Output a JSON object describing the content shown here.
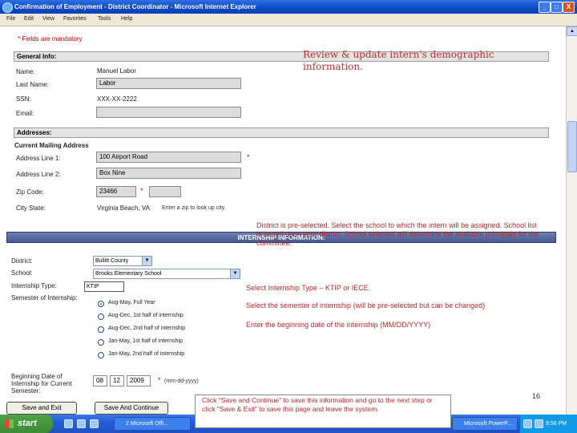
{
  "window": {
    "title": "Confirmation of Employment - District Coordinator - Microsoft Internet Explorer",
    "controls": [
      "_",
      "□",
      "X"
    ]
  },
  "menu": [
    "File",
    "Edit",
    "View",
    "Favorites",
    "Tools",
    "Help"
  ],
  "form": {
    "mandatory_note": "* Fields are mandatory",
    "general_header": "General Info:",
    "name_label": "Name:",
    "name_value": "Manuel Labor",
    "last_name_label": "Last Name:",
    "last_name_value": "Labor",
    "ssn_label": "SSN:",
    "ssn_value": "XXX-XX-2222",
    "email_label": "Email:",
    "email_value": "",
    "addresses_header": "Addresses:",
    "mailing_label": "Current Mailing Address",
    "addr1_label": "Address Line 1:",
    "addr1_value": "100 Airport Road",
    "addr2_label": "Address Line 2:",
    "addr2_value": "Box Nine",
    "zip_label": "Zip Code:",
    "zip_value": "23466",
    "city_label": "City State:",
    "city_value": "Virginia Beach, VA",
    "city_hint": "Enter a zip to look up city.",
    "star": "*"
  },
  "internship": {
    "header": "INTERNSHIP INFORMATION:",
    "district_label": "District:",
    "district_value": "Bullitt County",
    "school_label": "School:",
    "school_value": "Brooks Elementary School",
    "type_label": "Internship Type:",
    "type_value": "KTIP",
    "semester_label": "Semester of Internship:",
    "semesters": [
      {
        "label": "Aug-May, Full Year",
        "checked": true
      },
      {
        "label": "Aug-Dec, 1st half of internship",
        "checked": false
      },
      {
        "label": "Aug-Dec, 2nd half of internship",
        "checked": false
      },
      {
        "label": "Jan-May, 1st half of internship",
        "checked": false
      },
      {
        "label": "Jan-May, 2nd half of internship",
        "checked": false
      }
    ],
    "begin_label_1": "Beginning Date of",
    "begin_label_2": "Internship for Current",
    "begin_label_3": "Semester:",
    "date_mm": "08",
    "date_dd": "12",
    "date_yyyy": "2009",
    "date_hint": "(mm-dd-yyyy)",
    "save_exit": "Save and Exit",
    "save_continue": "Save And Continue"
  },
  "annotations": {
    "demographic": "Review & update intern's demographic information.",
    "district": "District is pre-selected. Select the school to which the intern will be assigned. School list is based upon your district. School selected will determine the available principals for the committee.",
    "type": "Select Internship Type – KTIP or IECE.",
    "semester": "Select the semester of internship (will be pre-selected but can be changed)",
    "date": "Enter the beginning date of the internship (MM/DD/YYYY)",
    "save": "Click \"Save and Continue\" to save this information and go to the next step or click \"Save & Exit\" to save this page and leave the system.",
    "page_number": "16"
  },
  "taskbar": {
    "start": "start",
    "tasks": [
      "2 Microsoft Offi...",
      "Microsoft PowerP..."
    ],
    "clock": "9:56 PM"
  }
}
